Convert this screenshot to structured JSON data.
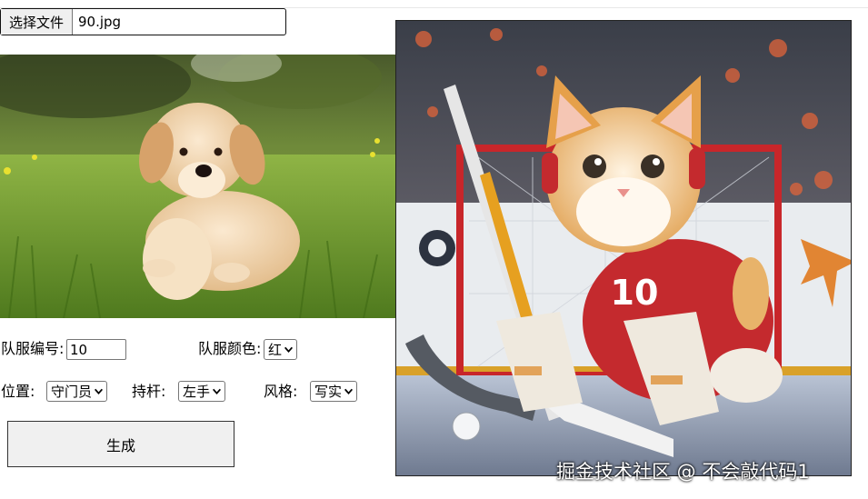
{
  "file_picker": {
    "button_label": "选择文件",
    "file_name": "90.jpg"
  },
  "form": {
    "number_label": "队服编号:",
    "number_value": "10",
    "color_label": "队服颜色:",
    "color_value": "红",
    "position_label": "位置:",
    "position_value": "守门员",
    "stick_label": "持杆:",
    "stick_value": "左手",
    "style_label": "风格:",
    "style_value": "写实",
    "generate_label": "生成"
  },
  "images": {
    "source_jersey_number": "10"
  },
  "watermark": "掘金技术社区 @ 不会敲代码1",
  "icons": {
    "dropdown": "chevron-down-icon"
  }
}
